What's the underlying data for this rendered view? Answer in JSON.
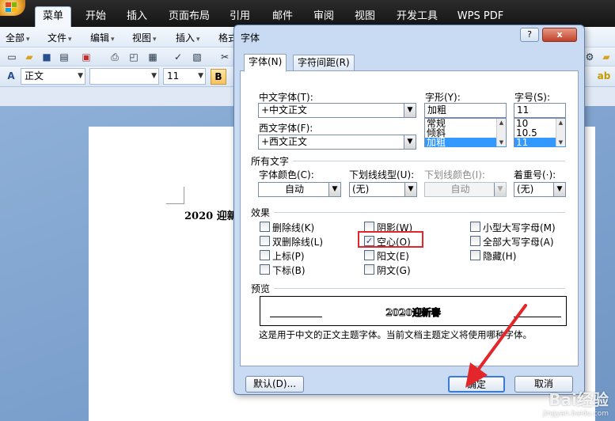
{
  "ribbon": {
    "tabs": [
      {
        "label": "菜单",
        "active": true
      },
      {
        "label": "开始"
      },
      {
        "label": "插入"
      },
      {
        "label": "页面布局"
      },
      {
        "label": "引用"
      },
      {
        "label": "邮件"
      },
      {
        "label": "审阅"
      },
      {
        "label": "视图"
      },
      {
        "label": "开发工具"
      },
      {
        "label": "WPS PDF"
      }
    ]
  },
  "menubar": {
    "items": [
      "全部",
      "文件",
      "编辑",
      "视图",
      "插入",
      "格式"
    ]
  },
  "format_toolbar": {
    "style_value": "正文",
    "font_value": "",
    "size_value": "11",
    "bold_label": "B"
  },
  "document": {
    "text": "2020 迎新"
  },
  "dialog": {
    "title": "字体",
    "help_label": "?",
    "close_label": "x",
    "tabs": [
      "字体(N)",
      "字符间距(R)"
    ],
    "labels": {
      "asian_font": "中文字体(T):",
      "latin_font": "西文字体(F):",
      "style": "字形(Y):",
      "size": "字号(S):",
      "all_text": "所有文字",
      "font_color": "字体颜色(C):",
      "underline_style": "下划线线型(U):",
      "underline_color": "下划线颜色(I):",
      "emphasis": "着重号(·):",
      "effects": "效果",
      "preview": "预览"
    },
    "asian_font_value": "+中文正文",
    "latin_font_value": "+西文正文",
    "style_value": "加粗",
    "style_options": [
      "常规",
      "倾斜",
      "加粗"
    ],
    "size_value": "11",
    "size_options": [
      "10",
      "10.5",
      "11"
    ],
    "font_color_value": "自动",
    "underline_style_value": "(无)",
    "underline_color_value": "自动",
    "emphasis_value": "(无)",
    "effects": {
      "strikethrough": "删除线(K)",
      "double_strikethrough": "双删除线(L)",
      "superscript": "上标(P)",
      "subscript": "下标(B)",
      "shadow": "阴影(W)",
      "outline": "空心(O)",
      "emboss": "阳文(E)",
      "engrave": "阴文(G)",
      "small_caps": "小型大写字母(M)",
      "all_caps": "全部大写字母(A)",
      "hidden": "隐藏(H)"
    },
    "outline_checked": true,
    "preview_text": "2020迎新春",
    "note": "这是用于中文的正文主题字体。当前文档主题定义将使用哪种字体。",
    "buttons": {
      "default": "默认(D)...",
      "ok": "确定",
      "cancel": "取消"
    }
  },
  "watermark": {
    "main": "Bai经验",
    "sub": "jingyan.baidu.com"
  },
  "colors": {
    "highlight": "#e2262a",
    "arrow": "#e2262a",
    "selection": "#3399ff"
  }
}
